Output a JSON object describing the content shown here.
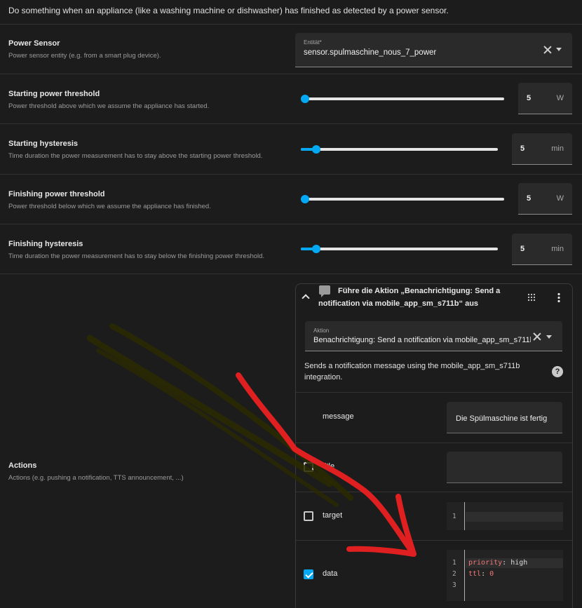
{
  "top_description": "Do something when an appliance (like a washing machine or dishwasher) has finished as detected by a power sensor.",
  "power_sensor": {
    "title": "Power Sensor",
    "description": "Power sensor entity (e.g. from a smart plug device).",
    "field_label": "Entität*",
    "value": "sensor.spulmaschine_nous_7_power"
  },
  "sliders": [
    {
      "title": "Starting power threshold",
      "description": "Power threshold above which we assume the appliance has started.",
      "value": "5",
      "unit": "W",
      "level": 0.02
    },
    {
      "title": "Starting hysteresis",
      "description": "Time duration the power measurement has to stay above the starting power threshold.",
      "value": "5",
      "unit": "min",
      "level": 0.08
    },
    {
      "title": "Finishing power threshold",
      "description": "Power threshold below which we assume the appliance has finished.",
      "value": "5",
      "unit": "W",
      "level": 0.02
    },
    {
      "title": "Finishing hysteresis",
      "description": "Time duration the power measurement has to stay below the finishing power threshold.",
      "value": "5",
      "unit": "min",
      "level": 0.08
    }
  ],
  "actions": {
    "title": "Actions",
    "description": "Actions (e.g. pushing a notification, TTS announcement, ...)",
    "card_title": "Führe die Aktion „Benachrichtigung: Send a notification via mobile_app_sm_s711b“ aus",
    "action_field_label": "Aktion",
    "action_value": "Benachrichtigung: Send a notification via mobile_app_sm_s711b",
    "service_description": "Sends a notification message using the mobile_app_sm_s711b integration.",
    "help_glyph": "?",
    "fields": {
      "message_label": "message",
      "message_value": "Die Spülmaschine ist fertig",
      "title_label": "title",
      "target_label": "target",
      "data_label": "data"
    },
    "target_code": {
      "line_numbers": [
        "1"
      ]
    },
    "data_code": {
      "line_numbers": [
        "1",
        "2",
        "3"
      ],
      "lines": [
        {
          "key": "priority",
          "sep": ": ",
          "value": "high"
        },
        {
          "key": "ttl",
          "sep": ": ",
          "value": "0"
        }
      ]
    }
  },
  "colors": {
    "accent": "#03a9f4",
    "annotation_arrow": "#e02020",
    "annotation_strokes": "#2b2a00"
  },
  "icons": [
    "close-icon",
    "dropdown-arrow-icon",
    "chevron-up-icon",
    "chat-bubble-icon",
    "drag-handle-icon",
    "more-vert-icon",
    "help-icon",
    "checkbox-icon"
  ]
}
